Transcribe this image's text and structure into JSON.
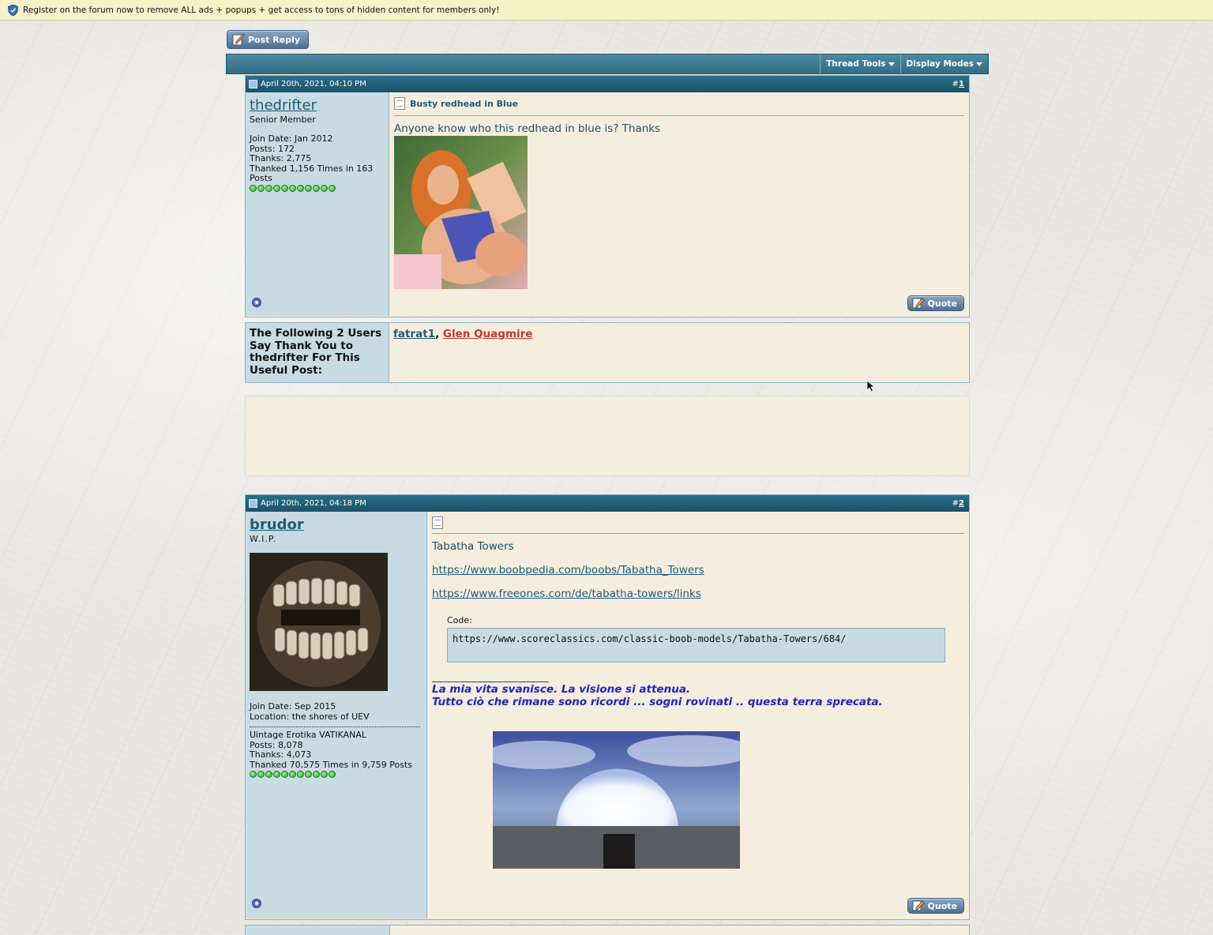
{
  "notice": {
    "text": "Register on the forum now to remove ALL ads + popups + get access to tons of hidden content for members only!"
  },
  "toolbar": {
    "post_reply": "Post Reply",
    "thread_tools": "Thread Tools",
    "display_modes": "Display Modes"
  },
  "posts": [
    {
      "date": "April 20th, 2021, 04:10 PM",
      "hash": "#",
      "number": "1",
      "username": "thedrifter",
      "user_title": "Senior Member",
      "join_date": "Join Date: Jan 2012",
      "posts": "Posts: 172",
      "thanks": "Thanks: 2,775",
      "thanked": "Thanked 1,156 Times in 163 Posts",
      "title": "Busty redhead in Blue",
      "message": "Anyone know who this redhead in blue is? Thanks",
      "quote": "Quote"
    },
    {
      "date": "April 20th, 2021, 04:18 PM",
      "hash": "#",
      "number": "2",
      "username": "brudor",
      "user_title": "W.I.P.",
      "join_date": "Join Date: Sep 2015",
      "location": "Location: the shores of UEV",
      "extra": "Uintage Erotika VATIKANAL",
      "posts": "Posts: 8,078",
      "thanks": "Thanks: 4,073",
      "thanked": "Thanked 70,575 Times in 9,759 Posts",
      "message": "Tabatha Towers",
      "link1": "https://www.boobpedia.com/boobs/Tabatha_Towers",
      "link2": "https://www.freeones.com/de/tabatha-towers/links",
      "code_label": "Code:",
      "code": "https://www.scoreclassics.com/classic-boob-models/Tabatha-Towers/684/",
      "sig1": "La mia vita svanisce. La visione si attenua.",
      "sig2": "Tutto ciò che rimane sono ricordi ... sogni rovinati .. questa terra sprecata.",
      "quote": "Quote"
    }
  ],
  "thanks_box": {
    "label": "The Following 2 Users Say Thank You to thedrifter For This Useful Post:",
    "user1": "fatrat1",
    "separator": ",",
    "user2": "Glen Quagmire"
  },
  "colors": {
    "header": "#1b5268",
    "userpane": "#c8dbe3",
    "content": "#f5eedf",
    "signature": "#2121c8"
  }
}
